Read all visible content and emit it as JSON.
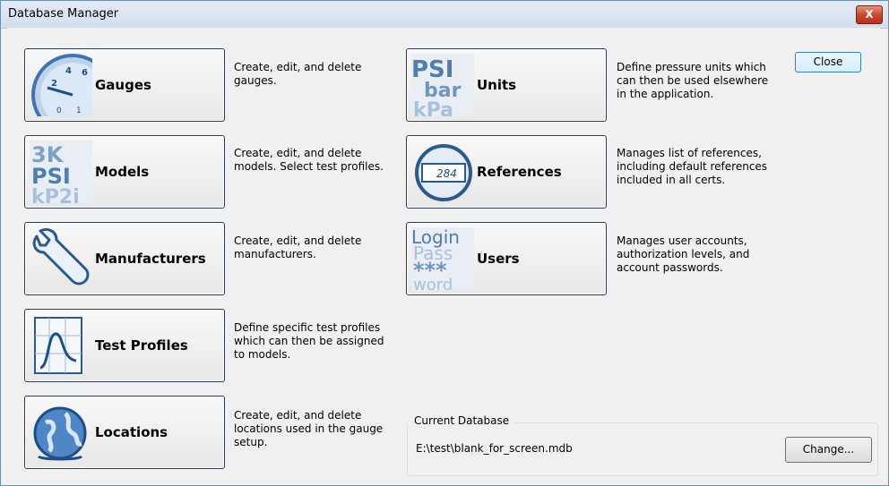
{
  "window": {
    "title": "Database Manager",
    "close_glyph": "X"
  },
  "buttons": {
    "gauges": {
      "label": "Gauges",
      "icon": "gauge-icon",
      "description": "Create, edit, and delete gauges."
    },
    "models": {
      "label": "Models",
      "icon": "models-icon",
      "icon_text": [
        "3K",
        "PSI",
        "kP2i"
      ],
      "description": "Create, edit, and delete models. Select test profiles."
    },
    "manufacturers": {
      "label": "Manufacturers",
      "icon": "wrench-icon",
      "description": "Create, edit, and delete manufacturers."
    },
    "test_profiles": {
      "label": "Test Profiles",
      "icon": "graph-paper-icon",
      "description": "Define specific test profiles which can then be assigned to models."
    },
    "locations": {
      "label": "Locations",
      "icon": "globe-icon",
      "description": "Create, edit, and delete locations used in the gauge setup."
    },
    "units": {
      "label": "Units",
      "icon": "units-icon",
      "icon_text": [
        "PSI",
        "bar",
        "kPa"
      ],
      "description": "Define pressure units which can then be used elsewhere in the application."
    },
    "references": {
      "label": "References",
      "icon": "reference-gauge-icon",
      "icon_text": [
        "284"
      ],
      "description": "Manages list of references, including default references included in all certs."
    },
    "users": {
      "label": "Users",
      "icon": "login-icon",
      "icon_text": [
        "Login",
        "Pass",
        "***",
        "word"
      ],
      "description": "Manages user accounts, authorization levels, and account passwords."
    }
  },
  "close_button": "Close",
  "current_database": {
    "group_title": "Current Database",
    "path": "E:\\test\\blank_for_screen.mdb",
    "change_button": "Change..."
  }
}
